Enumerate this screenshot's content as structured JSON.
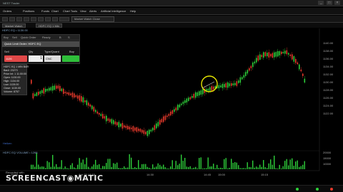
{
  "window": {
    "title": "NEST Trader",
    "controls": [
      "_",
      "□",
      "×"
    ]
  },
  "menu": [
    {
      "label": "Orders"
    },
    {
      "label": "Positions"
    },
    {
      "label": "Funds"
    },
    {
      "label": "Chart"
    },
    {
      "label": "Chart Tools"
    },
    {
      "label": "View"
    },
    {
      "label": "Alerts"
    },
    {
      "label": "Artificial Intelligence"
    },
    {
      "label": "Help"
    }
  ],
  "toolbar": {
    "exchange_tab": "Market Watch Close"
  },
  "tabs": [
    {
      "label": "Market Watch"
    },
    {
      "label": "HDFC EQ 1 Min"
    }
  ],
  "chart": {
    "header": "HDFC EQ • 1130.00",
    "symbol": "HDFC"
  },
  "order_panel": {
    "toolbar_items": [
      "Buy",
      "Sell",
      "Quick Order",
      "Ready",
      "B",
      "S"
    ],
    "title": "Quick Limit Order: HDFC EQ",
    "sell_label": "Sell",
    "qty_label": "Qty",
    "type_label": "Type/Quant",
    "buy_label": "Buy",
    "sell_price": "1126",
    "qty_value": "1",
    "product_value": "CNC"
  },
  "ohlc": [
    "HDFC EQ 1 MIN BAR",
    "Bar#: 23273",
    "Price Int: 1 11:00:00",
    "Open: 1130.00",
    "High: 1134.00",
    "Low: 1128.00",
    "Close: 1130.00",
    "Volume: 8757"
  ],
  "indicator_label": "Heiken",
  "volume_header": "HDFC EQ VOLUME  •  1268",
  "watermark": "SCREENCAST◉MATIC",
  "watermark_sub": "Recorded with",
  "colors": {
    "bull": "#2ecf3a",
    "bear": "#e8392b",
    "highlight": "#e6e600",
    "volume": "#2ecf3a"
  },
  "price_axis": [
    "1140.00",
    "1138.00",
    "1136.00",
    "1134.00",
    "1132.00",
    "1130.00",
    "1128.00",
    "1126.00",
    "1124.00",
    "1122.00"
  ],
  "volume_axis": [
    "20000",
    "15000",
    "10000"
  ],
  "time_axis": [
    "10:45",
    "Apr 23 14:15",
    "14:30",
    "14:45",
    "15:00",
    "15:15"
  ]
}
